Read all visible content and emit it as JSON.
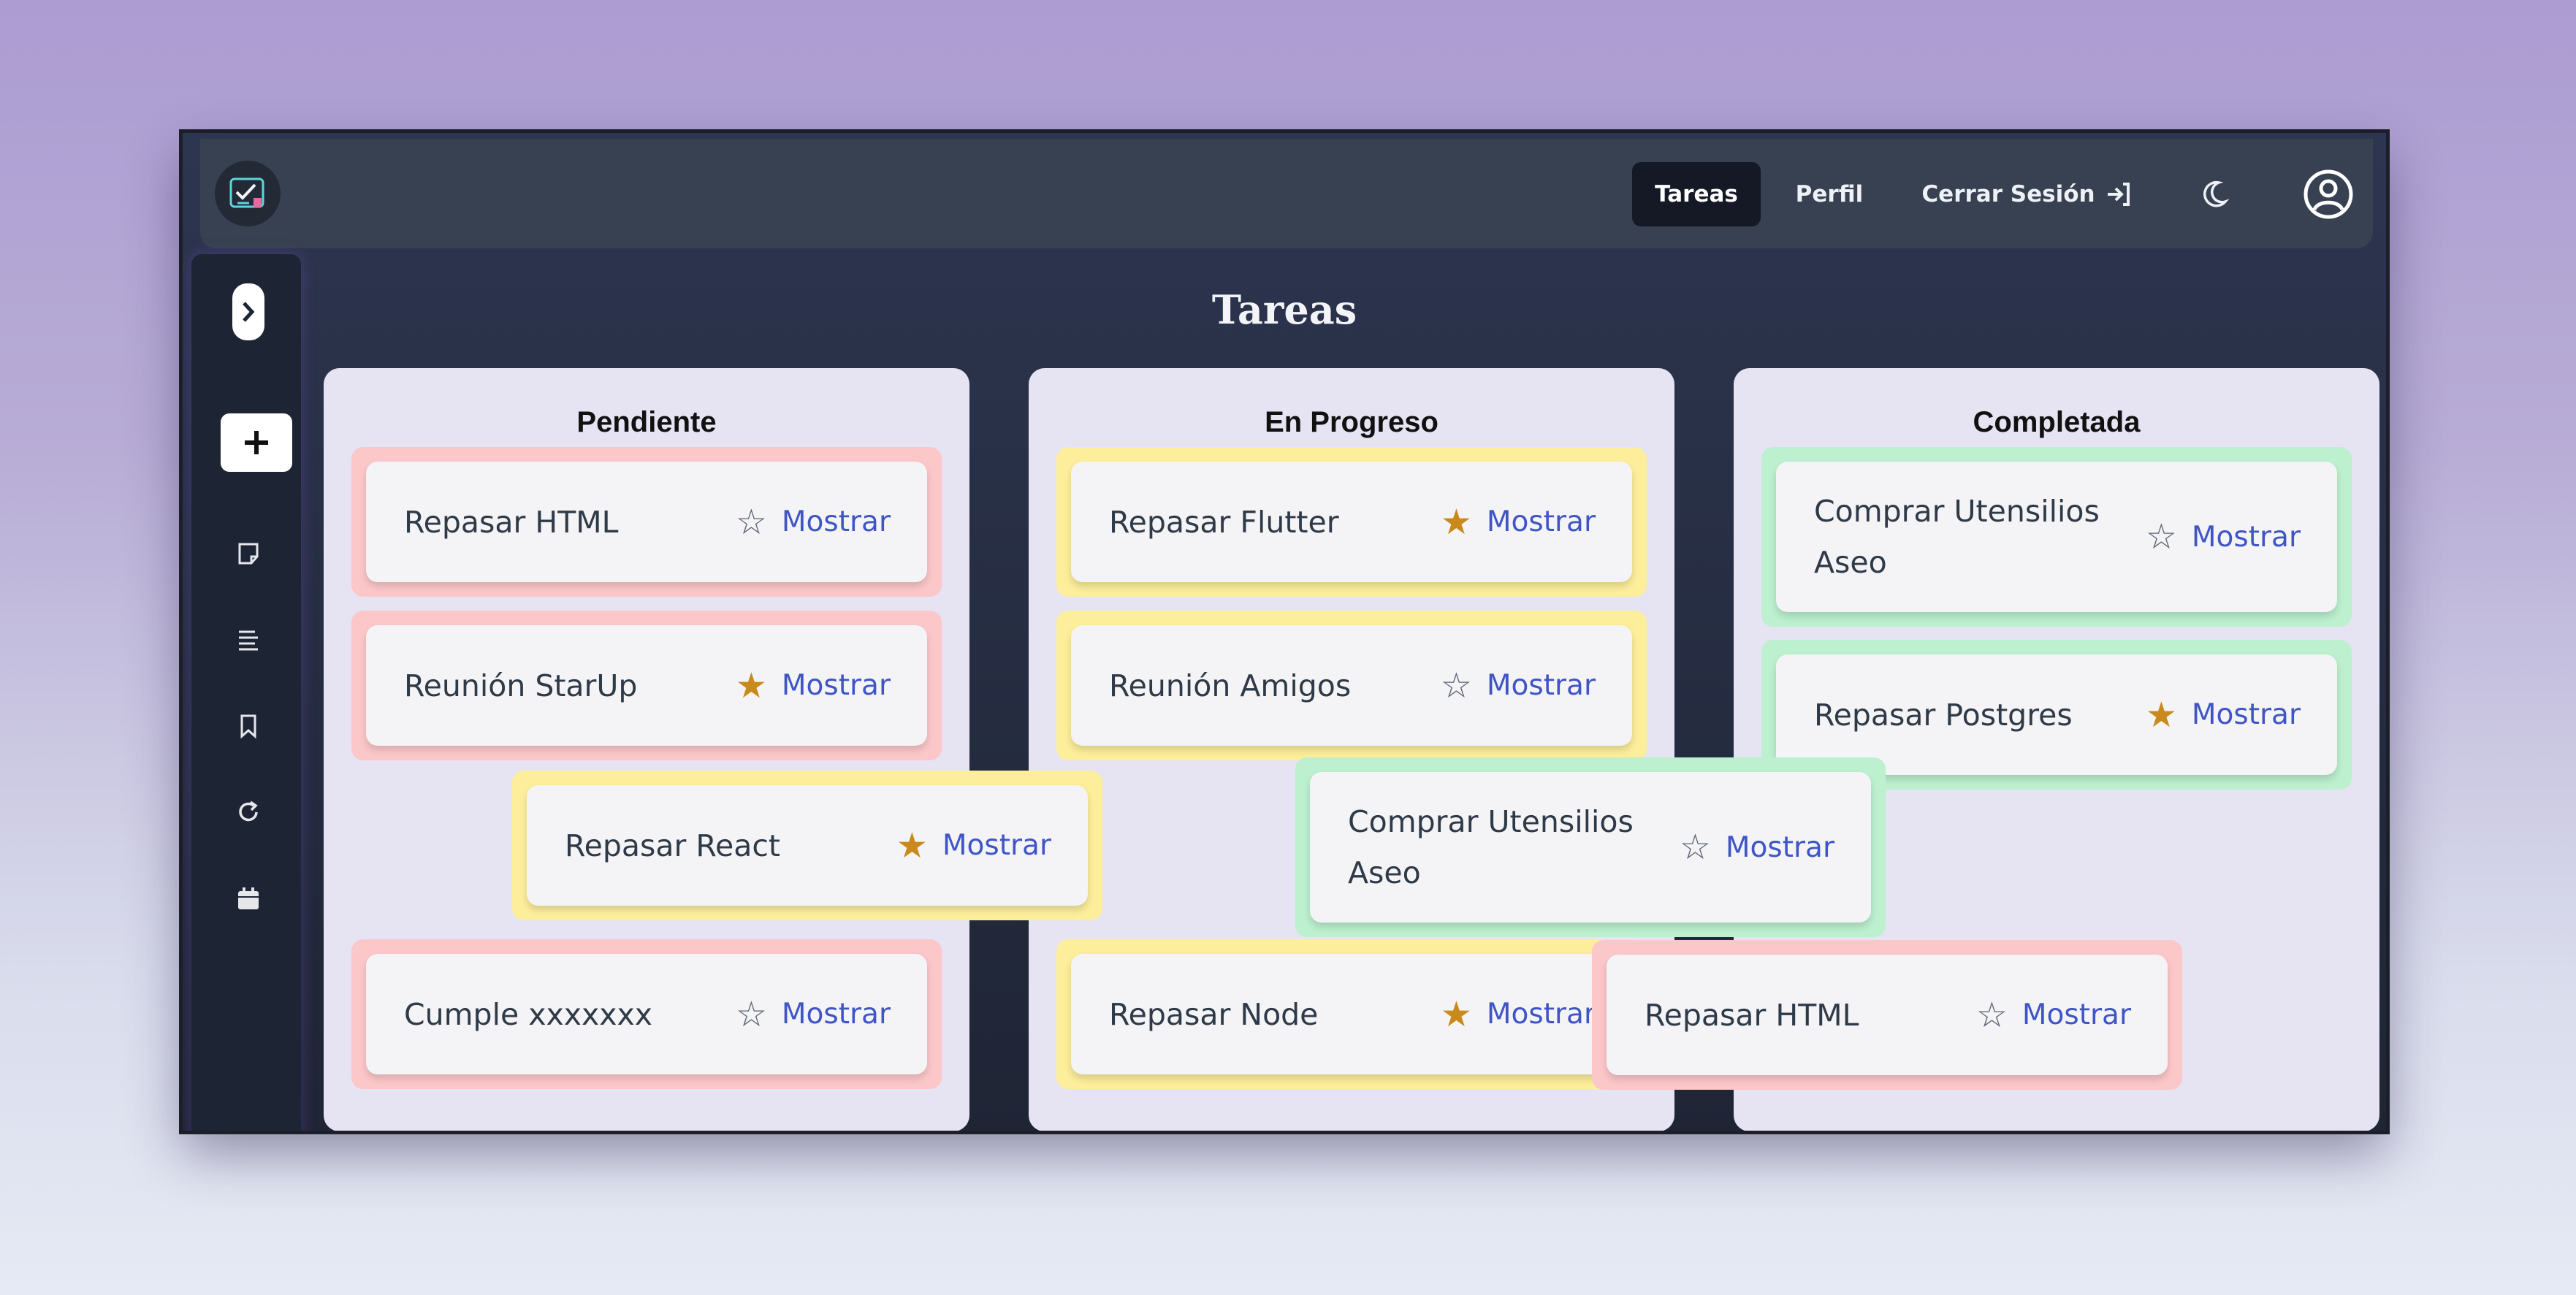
{
  "nav": {
    "tareas": "Tareas",
    "perfil": "Perfil",
    "cerrar_sesion": "Cerrar Sesión"
  },
  "board": {
    "title": "Tareas",
    "action_label": "Mostrar",
    "columns": [
      {
        "title": "Pendiente",
        "tasks": [
          {
            "name": "Repasar HTML",
            "priority": "alta",
            "favorite": false
          },
          {
            "name": "Reunión StarUp",
            "priority": "alta",
            "favorite": true
          },
          {
            "name": "Cumple xxxxxxx",
            "priority": "alta",
            "favorite": false
          }
        ]
      },
      {
        "title": "En Progreso",
        "tasks": [
          {
            "name": "Repasar Flutter",
            "priority": "media",
            "favorite": true
          },
          {
            "name": "Reunión Amigos",
            "priority": "media",
            "favorite": false
          },
          {
            "name": "Repasar Node",
            "priority": "media",
            "favorite": true
          }
        ]
      },
      {
        "title": "Completada",
        "tasks": [
          {
            "name": "Comprar Utensilios Aseo",
            "priority": "baja",
            "favorite": false
          },
          {
            "name": "Repasar Postgres",
            "priority": "baja",
            "favorite": true
          }
        ]
      }
    ],
    "dragging": [
      {
        "name": "Repasar React",
        "priority": "media",
        "favorite": true
      },
      {
        "name": "Comprar Utensilios Aseo",
        "priority": "baja",
        "favorite": false
      },
      {
        "name": "Repasar HTML",
        "priority": "alta",
        "favorite": false
      }
    ]
  },
  "colors": {
    "high": "#fcc7c9",
    "medium": "#fcee9a",
    "low": "#bcf0cf",
    "star_on": "#c9891b",
    "link": "#3f55c6"
  },
  "icons": {
    "star_filled": "★",
    "star_empty": "☆"
  }
}
